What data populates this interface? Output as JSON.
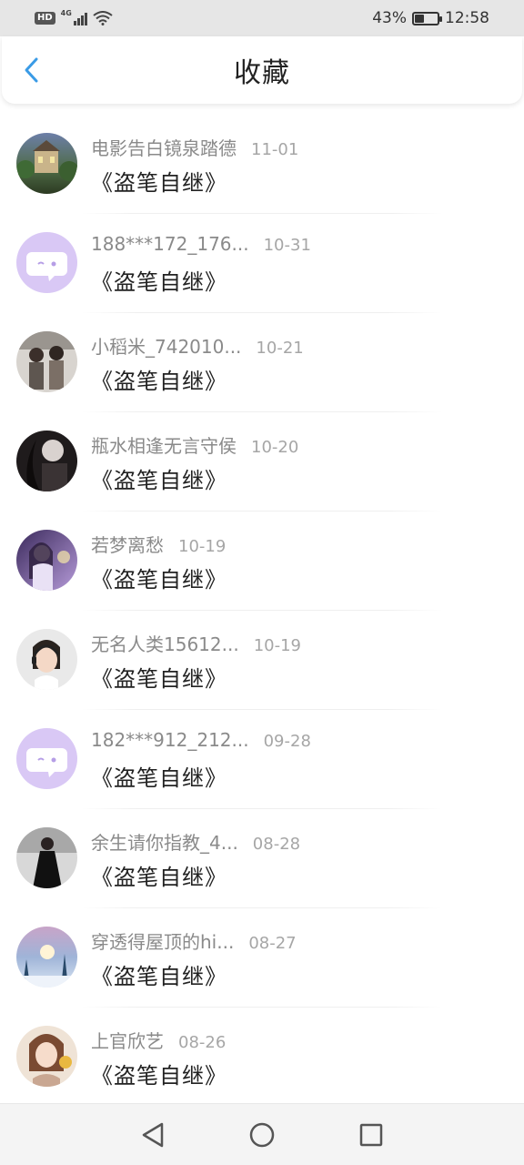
{
  "status_bar": {
    "hd_badge": "HD",
    "network": "4G",
    "battery_percent": "43%",
    "battery_level": 0.43,
    "time": "12:58"
  },
  "header": {
    "title": "收藏",
    "back_icon": "chevron-left-icon",
    "accent_color": "#3a9be6"
  },
  "favorites": [
    {
      "user": "电影告白镜泉踏德",
      "date": "11-01",
      "title": "《盗笔自继》",
      "avatar": "avatar-castle"
    },
    {
      "user": "188***172_176...",
      "date": "10-31",
      "title": "《盗笔自继》",
      "avatar": "avatar-default"
    },
    {
      "user": "小稻米_742010...",
      "date": "10-21",
      "title": "《盗笔自继》",
      "avatar": "avatar-pair"
    },
    {
      "user": "瓶水相逢无言守侯",
      "date": "10-20",
      "title": "《盗笔自继》",
      "avatar": "avatar-dark"
    },
    {
      "user": "若梦离愁",
      "date": "10-19",
      "title": "《盗笔自继》",
      "avatar": "avatar-purple"
    },
    {
      "user": "无名人类15612...",
      "date": "10-19",
      "title": "《盗笔自继》",
      "avatar": "avatar-headset"
    },
    {
      "user": "182***912_212...",
      "date": "09-28",
      "title": "《盗笔自继》",
      "avatar": "avatar-default"
    },
    {
      "user": "余生请你指教_4...",
      "date": "08-28",
      "title": "《盗笔自继》",
      "avatar": "avatar-dress"
    },
    {
      "user": "穿透得屋顶的hi...",
      "date": "08-27",
      "title": "《盗笔自继》",
      "avatar": "avatar-snow"
    },
    {
      "user": "上官欣艺",
      "date": "08-26",
      "title": "《盗笔自继》",
      "avatar": "avatar-girl"
    }
  ],
  "nav_bar": {
    "back_icon": "triangle-back-icon",
    "home_icon": "circle-home-icon",
    "recents_icon": "square-recents-icon"
  }
}
